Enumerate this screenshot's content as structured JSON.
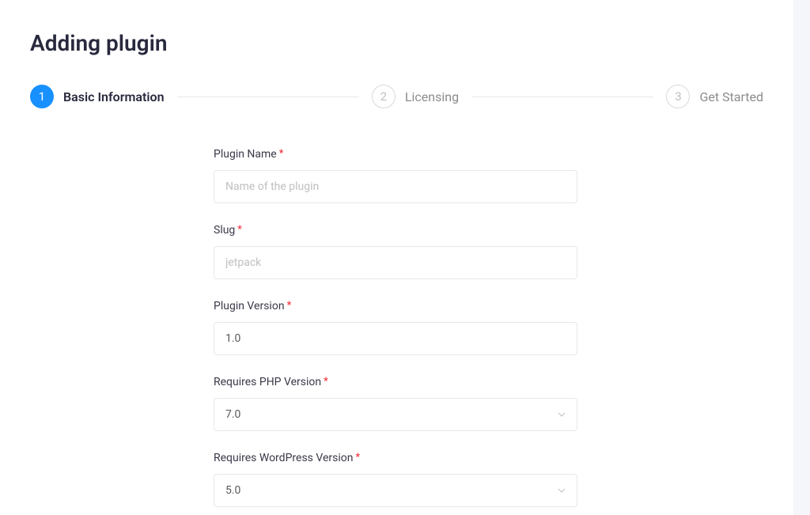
{
  "page_title": "Adding plugin",
  "stepper": {
    "steps": [
      {
        "number": "1",
        "label": "Basic Information",
        "active": true
      },
      {
        "number": "2",
        "label": "Licensing",
        "active": false
      },
      {
        "number": "3",
        "label": "Get Started",
        "active": false
      }
    ]
  },
  "form": {
    "plugin_name": {
      "label": "Plugin Name",
      "placeholder": "Name of the plugin",
      "value": ""
    },
    "slug": {
      "label": "Slug",
      "placeholder": "jetpack",
      "value": ""
    },
    "plugin_version": {
      "label": "Plugin Version",
      "value": "1.0"
    },
    "php_version": {
      "label": "Requires PHP Version",
      "value": "7.0"
    },
    "wp_version": {
      "label": "Requires WordPress Version",
      "value": "5.0"
    }
  },
  "asterisk": "*"
}
